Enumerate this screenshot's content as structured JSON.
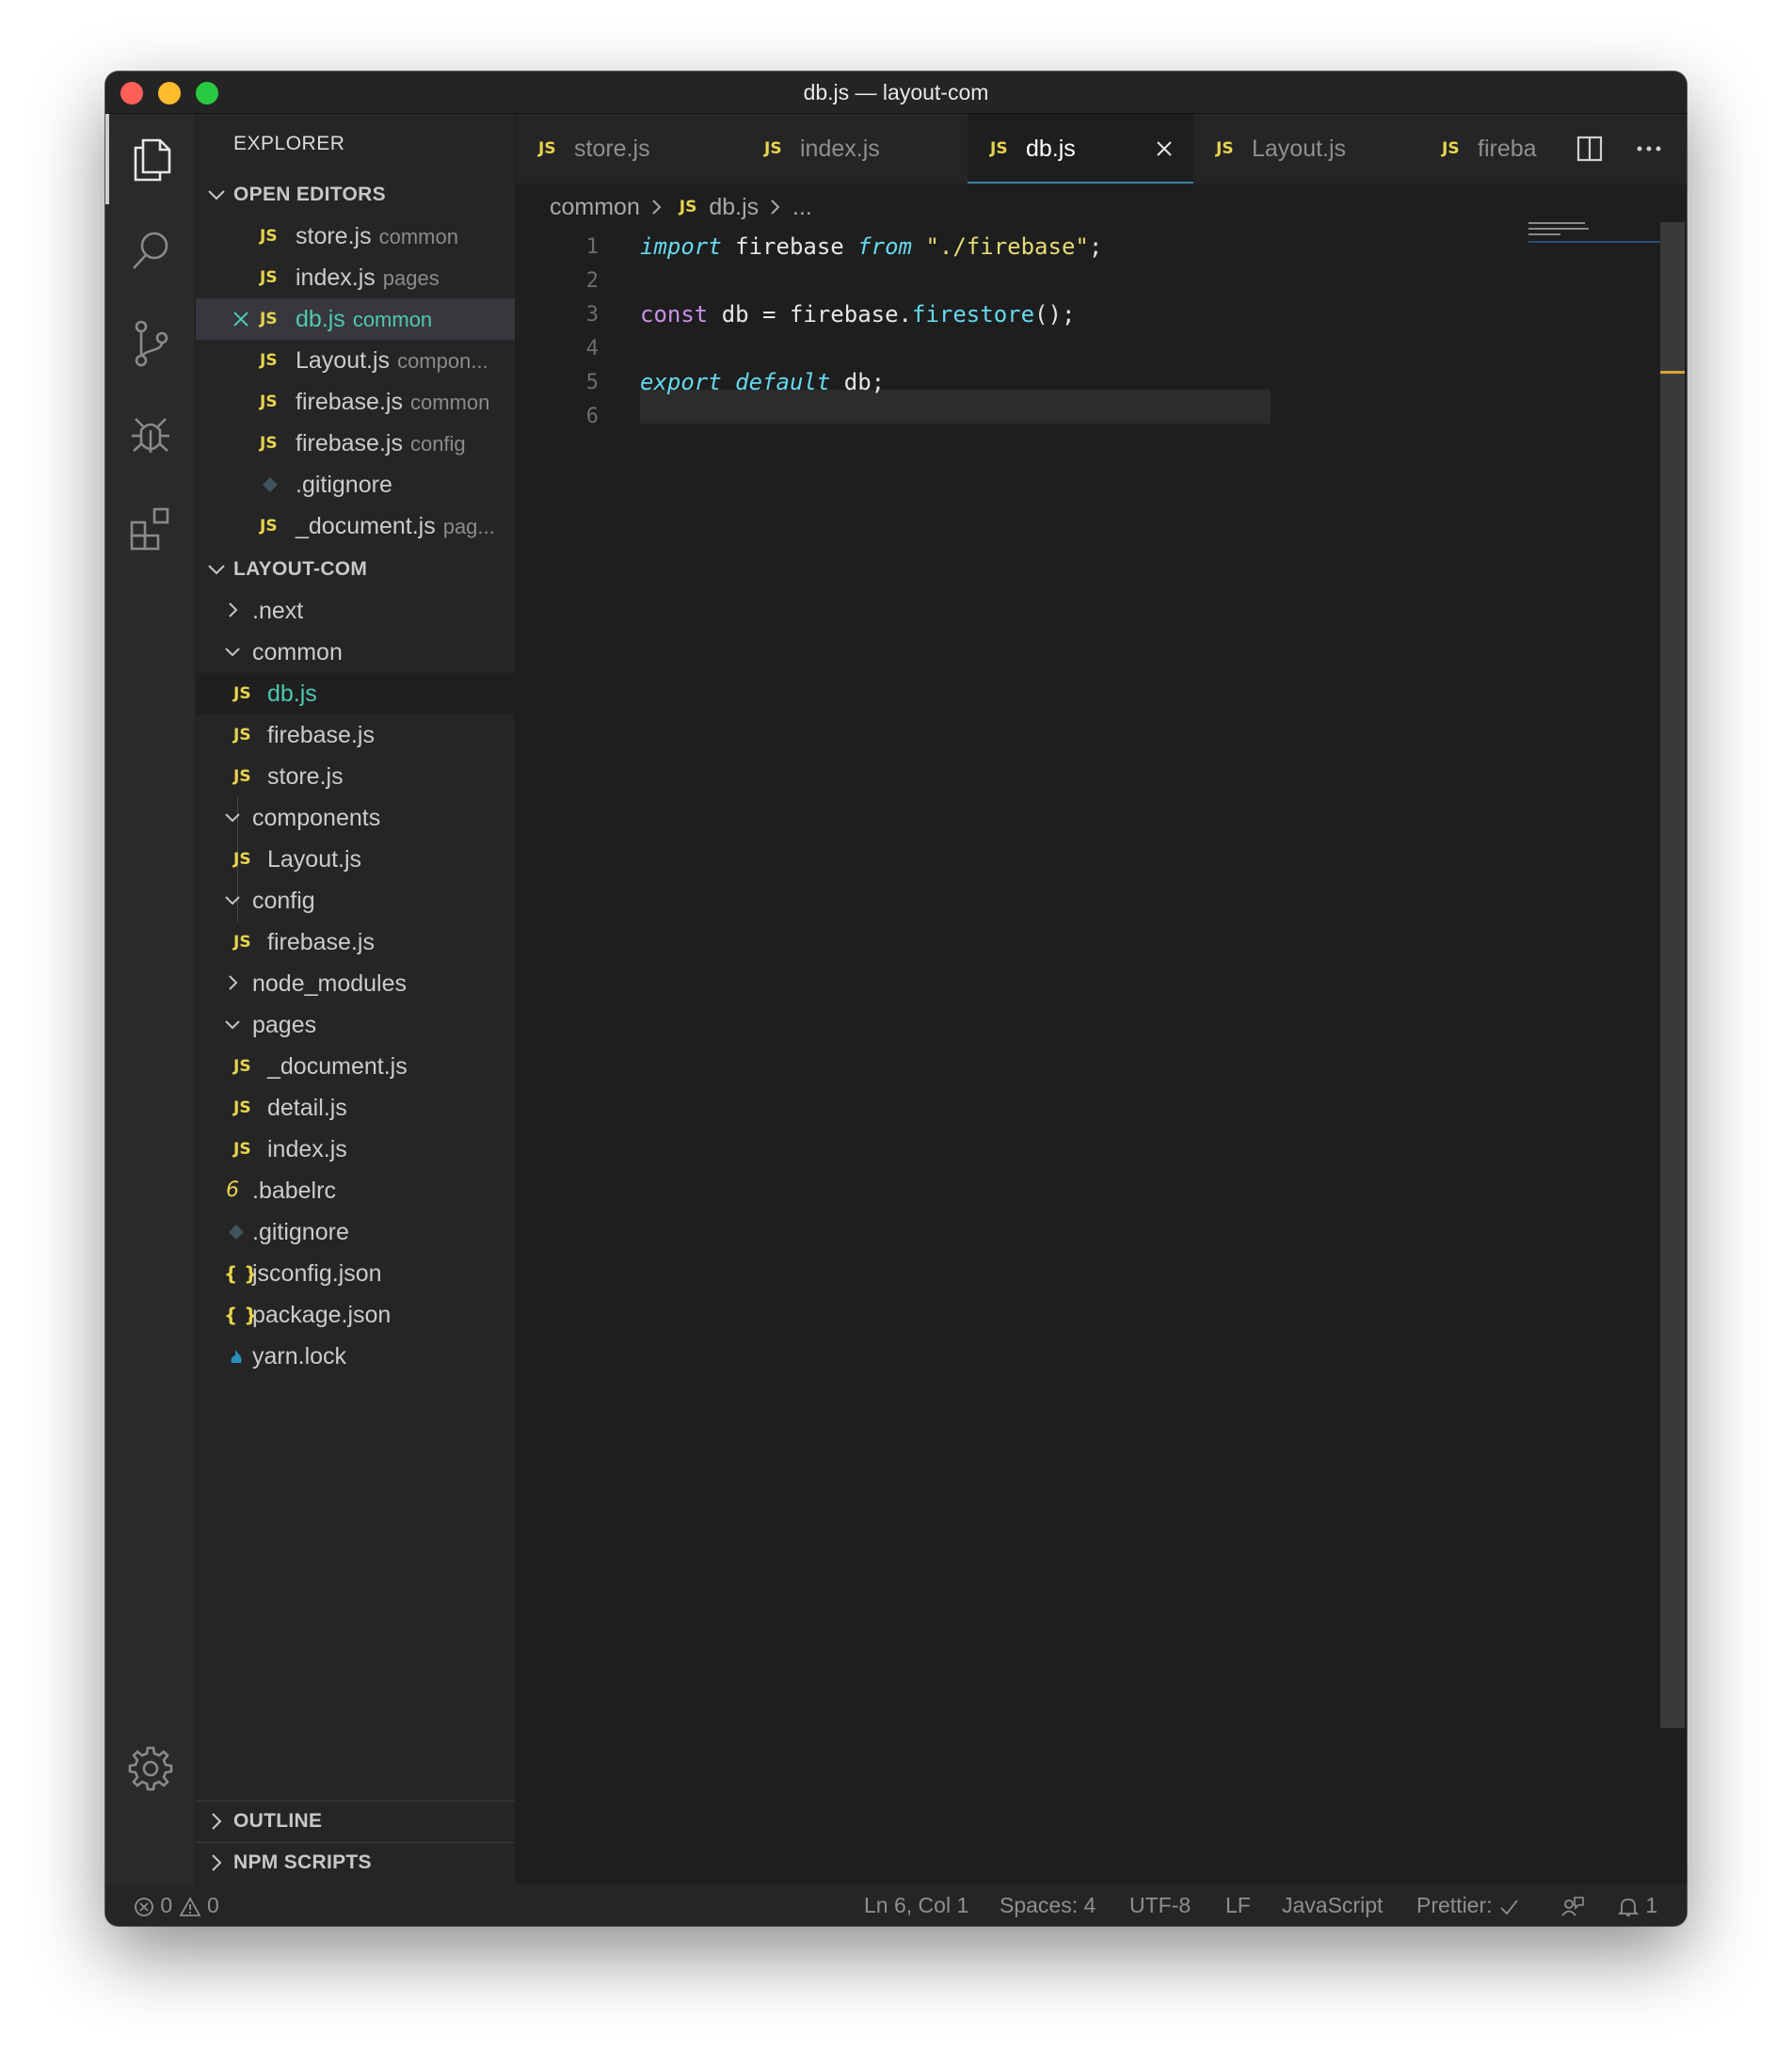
{
  "window": {
    "title": "db.js — layout-com"
  },
  "sidebar": {
    "title": "EXPLORER",
    "open_editors": {
      "header": "OPEN EDITORS",
      "items": [
        {
          "name": "store.js",
          "hint": "common"
        },
        {
          "name": "index.js",
          "hint": "pages"
        },
        {
          "name": "db.js",
          "hint": "common"
        },
        {
          "name": "Layout.js",
          "hint": "compon..."
        },
        {
          "name": "firebase.js",
          "hint": "common"
        },
        {
          "name": "firebase.js",
          "hint": "config"
        },
        {
          "name": ".gitignore",
          "hint": ""
        },
        {
          "name": "_document.js",
          "hint": "pag..."
        }
      ]
    },
    "project": {
      "header": "LAYOUT-COM",
      "items": [
        {
          "name": ".next"
        },
        {
          "name": "common"
        },
        {
          "name": "db.js"
        },
        {
          "name": "firebase.js"
        },
        {
          "name": "store.js"
        },
        {
          "name": "components"
        },
        {
          "name": "Layout.js"
        },
        {
          "name": "config"
        },
        {
          "name": "firebase.js"
        },
        {
          "name": "node_modules"
        },
        {
          "name": "pages"
        },
        {
          "name": "_document.js"
        },
        {
          "name": "detail.js"
        },
        {
          "name": "index.js"
        },
        {
          "name": ".babelrc"
        },
        {
          "name": ".gitignore"
        },
        {
          "name": "jsconfig.json"
        },
        {
          "name": "package.json"
        },
        {
          "name": "yarn.lock"
        }
      ]
    },
    "outline": "OUTLINE",
    "npm_scripts": "NPM SCRIPTS"
  },
  "tabs": [
    {
      "label": "store.js"
    },
    {
      "label": "index.js"
    },
    {
      "label": "db.js"
    },
    {
      "label": "Layout.js"
    },
    {
      "label": "fireba"
    }
  ],
  "icons": {
    "js": "JS",
    "json": "{ }",
    "babel": "6"
  },
  "breadcrumb": {
    "folder": "common",
    "file": "db.js",
    "more": "..."
  },
  "editor": {
    "line_numbers": [
      "1",
      "2",
      "3",
      "4",
      "5",
      "6"
    ],
    "line1": {
      "kw": "import",
      "id": " firebase ",
      "kw2": "from",
      "str": " \"./firebase\"",
      "end": ";"
    },
    "line3": {
      "kw": "const",
      "rest": " db = firebase.",
      "fn": "firestore",
      "end": "();"
    },
    "line5": {
      "kw": "export",
      "kw2": "default",
      "rest": " db;"
    }
  },
  "status": {
    "errors": "0",
    "warnings": "0",
    "position": "Ln 6, Col 1",
    "spaces": "Spaces: 4",
    "encoding": "UTF-8",
    "eol": "LF",
    "language": "JavaScript",
    "prettier": "Prettier:",
    "notifications": "1"
  },
  "colors": {
    "accent_teal": "#4ec9b0",
    "js_yellow": "#e8d44d",
    "keyword_blue": "#66d9ef",
    "keyword_purple": "#c792ea",
    "string_yellow": "#e6db74"
  }
}
